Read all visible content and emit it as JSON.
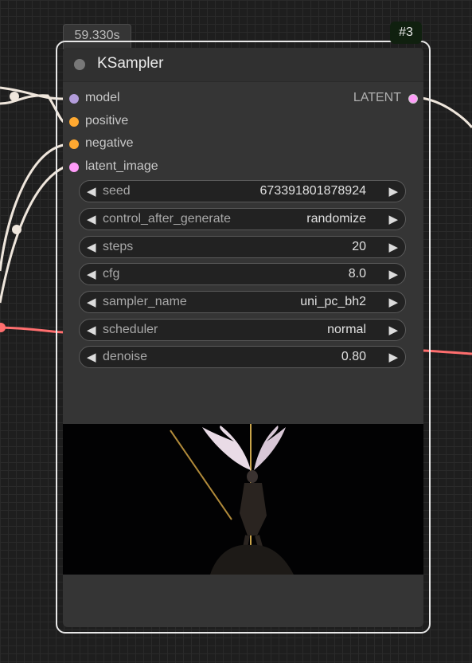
{
  "node": {
    "timing": "59.330s",
    "id_badge": "#3",
    "title": "KSampler",
    "colors": {
      "node_body": "#353535",
      "selection_outline": "#e8e8e8",
      "model_slot": "#b39ddb",
      "conditioning_slot": "#ffa931",
      "latent_slot": "#ff9cf9",
      "latent_wire": "#ff6e6e"
    }
  },
  "inputs": [
    {
      "label": "model",
      "color": "#b39ddb"
    },
    {
      "label": "positive",
      "color": "#ffa931"
    },
    {
      "label": "negative",
      "color": "#ffa931"
    },
    {
      "label": "latent_image",
      "color": "#ff9cf9"
    }
  ],
  "output": {
    "label": "LATENT"
  },
  "widgets": [
    {
      "name": "seed",
      "value": "673391801878924"
    },
    {
      "name": "control_after_generate",
      "value": "randomize"
    },
    {
      "name": "steps",
      "value": "20"
    },
    {
      "name": "cfg",
      "value": "8.0"
    },
    {
      "name": "sampler_name",
      "value": "uni_pc_bh2"
    },
    {
      "name": "scheduler",
      "value": "normal"
    },
    {
      "name": "denoise",
      "value": "0.80"
    }
  ],
  "icons": {
    "decrement": "◀",
    "increment": "▶",
    "collapse": "node-collapse-dot-icon"
  }
}
